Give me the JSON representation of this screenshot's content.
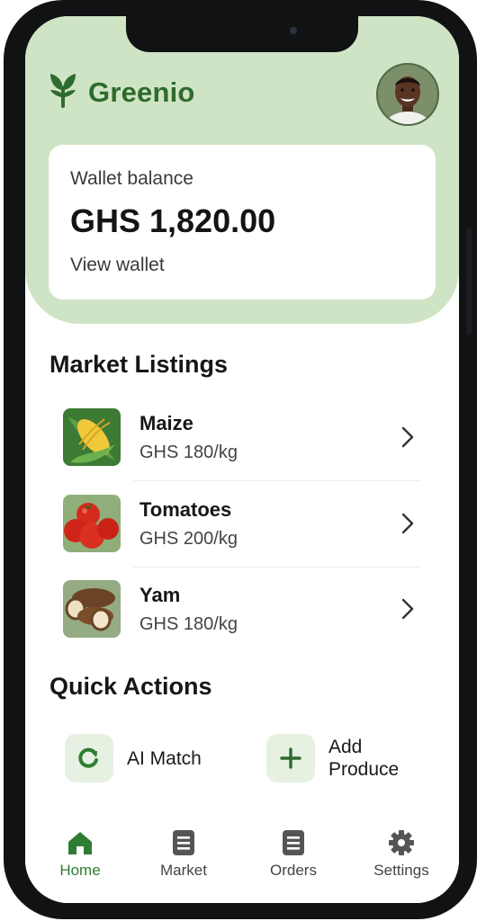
{
  "app": {
    "name": "Greenio",
    "logo_icon": "sprout-icon",
    "avatar": "user-avatar"
  },
  "wallet": {
    "label": "Wallet balance",
    "amount": "GHS 1,820.00",
    "link_label": "View wallet"
  },
  "market": {
    "title": "Market Listings",
    "items": [
      {
        "name": "Maize",
        "price": "GHS 180/kg",
        "icon": "maize-image"
      },
      {
        "name": "Tomatoes",
        "price": "GHS 200/kg",
        "icon": "tomatoes-image"
      },
      {
        "name": "Yam",
        "price": "GHS 180/kg",
        "icon": "yam-image"
      }
    ]
  },
  "quick_actions": {
    "title": "Quick Actions",
    "items": [
      {
        "label": "AI Match",
        "icon": "refresh-icon"
      },
      {
        "label_line1": "Add",
        "label_line2": "Produce",
        "icon": "plus-icon"
      }
    ]
  },
  "tabs": [
    {
      "label": "Home",
      "icon": "home-icon",
      "active": true
    },
    {
      "label": "Market",
      "icon": "list-icon",
      "active": false
    },
    {
      "label": "Orders",
      "icon": "list-icon",
      "active": false
    },
    {
      "label": "Settings",
      "icon": "gear-icon",
      "active": false
    }
  ],
  "colors": {
    "brand_green": "#2e6b2e",
    "header_bg": "#cfe4c4",
    "active_tab": "#2e7d32",
    "icon_bg": "#e6f1e2"
  }
}
